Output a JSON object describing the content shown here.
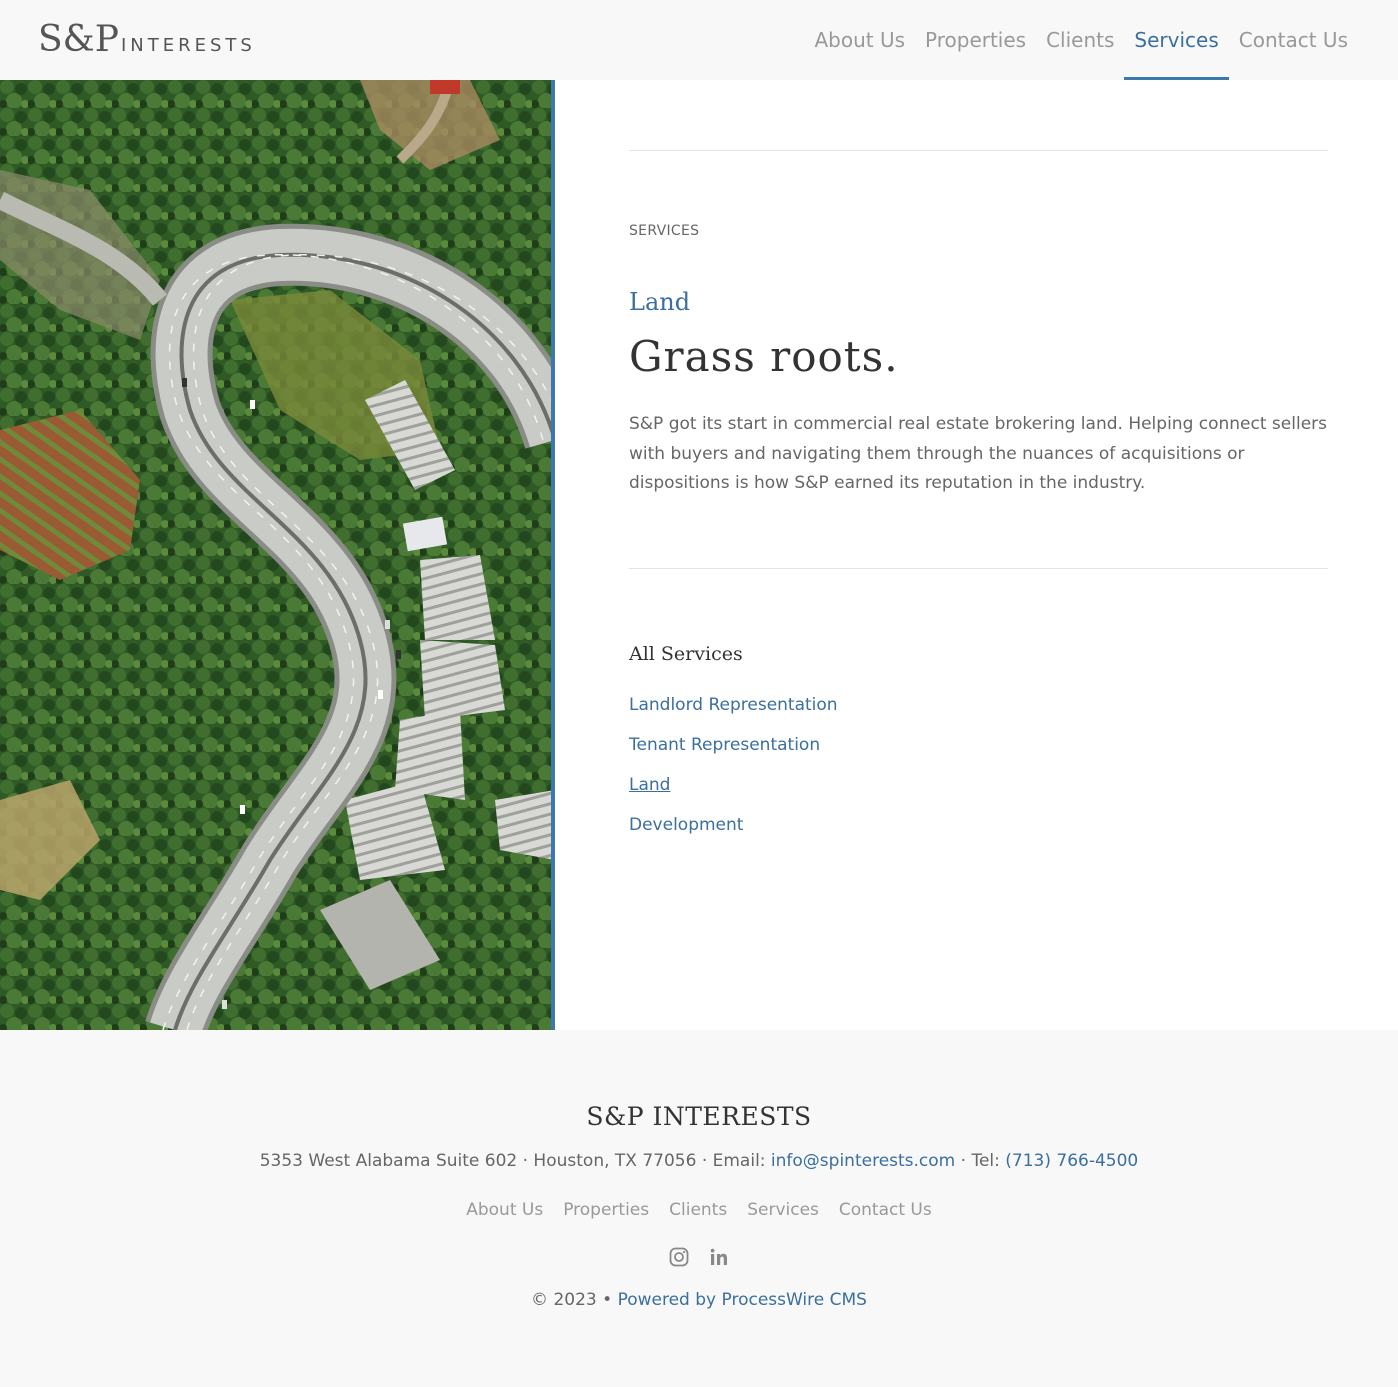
{
  "header": {
    "logo_main": "S&P",
    "logo_sub": "INTERESTS",
    "nav": [
      {
        "label": "About Us",
        "active": false
      },
      {
        "label": "Properties",
        "active": false
      },
      {
        "label": "Clients",
        "active": false
      },
      {
        "label": "Services",
        "active": true
      },
      {
        "label": "Contact Us",
        "active": false
      }
    ]
  },
  "main": {
    "kicker": "SERVICES",
    "subtitle": "Land",
    "title": "Grass roots.",
    "body": "S&P got its start in commercial real estate brokering land. Helping connect sellers with buyers and navigating them through the nuances of acquisitions or dispositions is how S&P earned its reputation in the industry.",
    "all_services_title": "All Services",
    "services": [
      {
        "label": "Landlord Representation",
        "current": false
      },
      {
        "label": "Tenant Representation",
        "current": false
      },
      {
        "label": "Land",
        "current": true
      },
      {
        "label": "Development",
        "current": false
      }
    ],
    "image_icon": "aerial-road-photo"
  },
  "footer": {
    "brand": "S&P INTERESTS",
    "address_text": "5353 West Alabama Suite 602 · Houston, TX 77056 · Email: ",
    "email": "info@spinterests.com",
    "tel_prefix": " · Tel: ",
    "tel": "(713) 766-4500",
    "nav": [
      "About Us",
      "Properties",
      "Clients",
      "Services",
      "Contact Us"
    ],
    "social": [
      "instagram-icon",
      "linkedin-icon"
    ],
    "copyright": "© 2023 • ",
    "powered": "Powered by ProcessWire CMS"
  },
  "colors": {
    "accent": "#3a6f9f",
    "accent_bar": "#3a78ad",
    "background": "#f8f8f8"
  }
}
